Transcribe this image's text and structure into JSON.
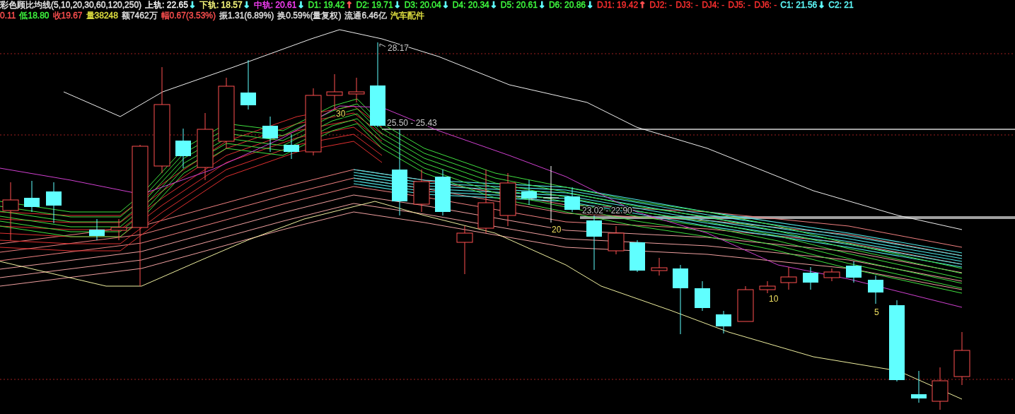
{
  "indicator_bar": {
    "title": "彩色顾比均线(5,10,20,30,60,120,250)",
    "values": [
      {
        "label": "上轨: 22.65",
        "color": "#ffffff",
        "arrow": {
          "glyph": "↓",
          "color": "#60ffff"
        }
      },
      {
        "label": "下轨: 18.57",
        "color": "#ffff80",
        "arrow": {
          "glyph": "↓",
          "color": "#60ffff"
        }
      },
      {
        "label": "中轨: 20.61",
        "color": "#ff40ff",
        "arrow": {
          "glyph": "↓",
          "color": "#60ffff"
        }
      },
      {
        "label": "D1: 19.42",
        "color": "#40ff40",
        "arrow": {
          "glyph": "↑",
          "color": "#ff5050"
        }
      },
      {
        "label": "D2: 19.71",
        "color": "#40ff40",
        "arrow": {
          "glyph": "↓",
          "color": "#60ffff"
        }
      },
      {
        "label": "D3: 20.04",
        "color": "#40ff40",
        "arrow": {
          "glyph": "↓",
          "color": "#60ffff"
        }
      },
      {
        "label": "D4: 20.34",
        "color": "#40ff40",
        "arrow": {
          "glyph": "↓",
          "color": "#60ffff"
        }
      },
      {
        "label": "D5: 20.61",
        "color": "#40ff40",
        "arrow": {
          "glyph": "↓",
          "color": "#60ffff"
        }
      },
      {
        "label": "D6: 20.86",
        "color": "#40ff40",
        "arrow": {
          "glyph": "↓",
          "color": "#60ffff"
        }
      },
      {
        "label": "DJ1: 19.42",
        "color": "#ff3030",
        "arrow": {
          "glyph": "↑",
          "color": "#ff5050"
        }
      },
      {
        "label": "DJ2: -",
        "color": "#ff3030"
      },
      {
        "label": "DJ3: -",
        "color": "#ff3030"
      },
      {
        "label": "DJ4: -",
        "color": "#ff3030"
      },
      {
        "label": "DJ5: -",
        "color": "#ff3030"
      },
      {
        "label": "DJ6: -",
        "color": "#ff3030"
      },
      {
        "label": "C1: 21.56",
        "color": "#60ffff",
        "arrow": {
          "glyph": "↓",
          "color": "#60ffff"
        }
      },
      {
        "label": "C2: 21",
        "color": "#60ffff"
      }
    ]
  },
  "quote_bar": [
    {
      "text": "0.11",
      "color": "#ff5050"
    },
    {
      "text": "低18.80",
      "color": "#40ff40"
    },
    {
      "text": "收19.67",
      "color": "#ff5050"
    },
    {
      "text": "量38248",
      "color": "#e0e040"
    },
    {
      "text": "额7462万",
      "color": "#e0e0e0"
    },
    {
      "text": "幅0.67(3.53%)",
      "color": "#ff5050"
    },
    {
      "text": "振1.31(6.89%)",
      "color": "#e0e0e0"
    },
    {
      "text": "换0.59%(量复权)",
      "color": "#e0e0e0"
    },
    {
      "text": "流通6.46亿",
      "color": "#e0e0e0"
    },
    {
      "text": "汽车配件",
      "color": "#e0e040"
    }
  ],
  "chart": {
    "annotations": [
      {
        "kind": "high",
        "text": "28.17"
      },
      {
        "kind": "range",
        "text": "25.50 - 25.43"
      },
      {
        "kind": "range",
        "text": "23.02 - 22.90"
      },
      {
        "kind": "period",
        "text": "30"
      },
      {
        "kind": "period",
        "text": "20"
      },
      {
        "kind": "period",
        "text": "10"
      },
      {
        "kind": "period",
        "text": "5"
      }
    ]
  }
}
